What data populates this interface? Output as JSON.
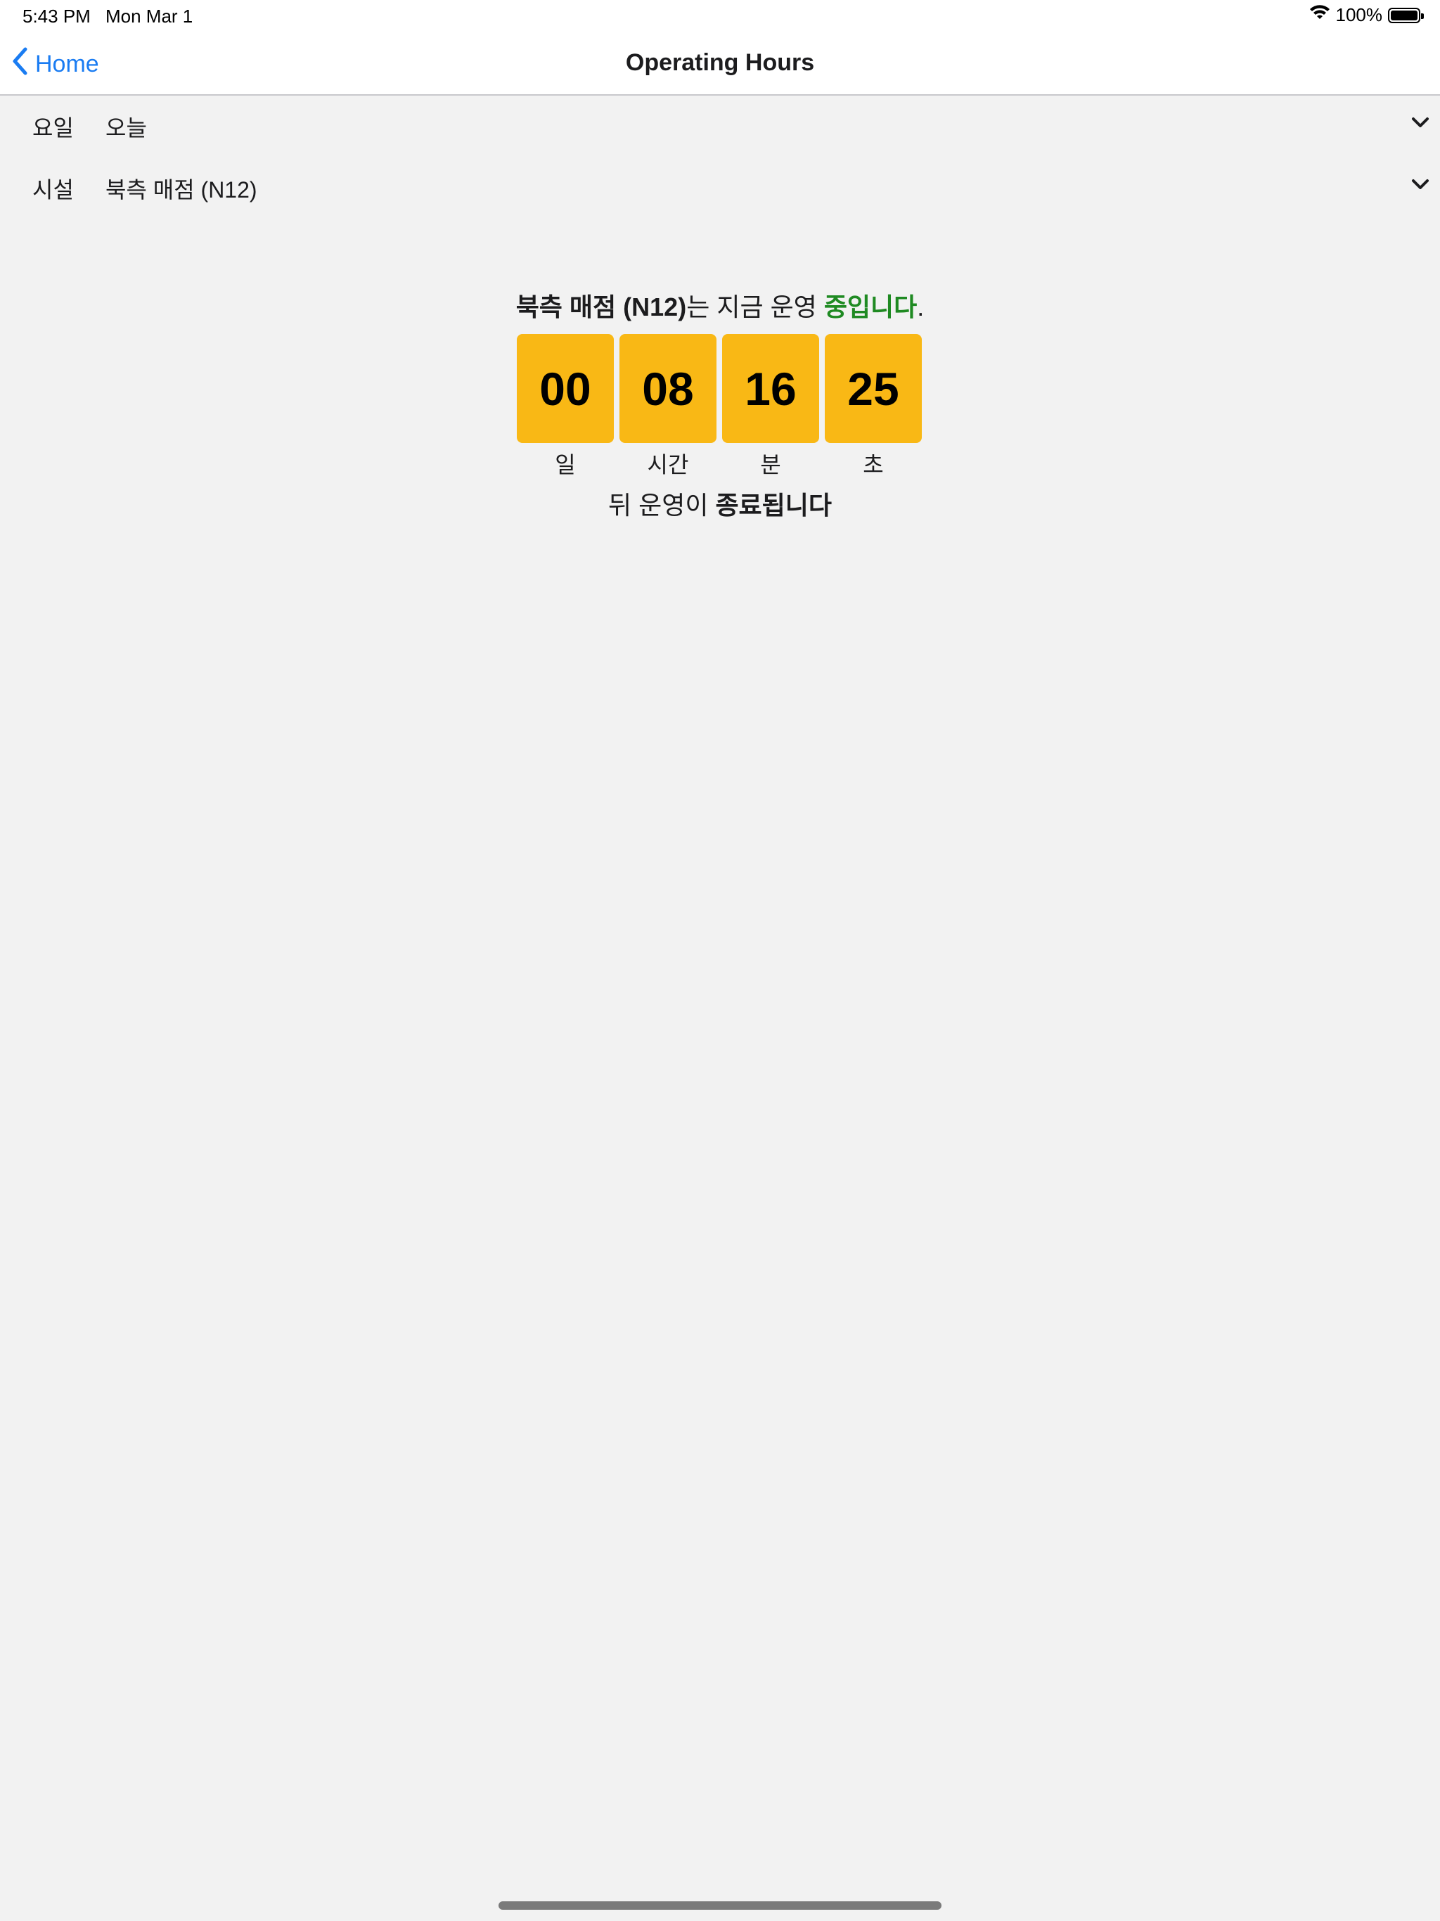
{
  "status_bar": {
    "time": "5:43 PM",
    "date": "Mon Mar 1",
    "battery": "100%"
  },
  "nav": {
    "back_label": "Home",
    "title": "Operating Hours"
  },
  "day_selector": {
    "label": "요일",
    "value": "오늘"
  },
  "facility_selector": {
    "label": "시설",
    "value": "북측 매점 (N12)"
  },
  "status_message": {
    "facility": "북측 매점 (N12)",
    "middle": "는 지금 운영 ",
    "state": "중입니다",
    "end": "."
  },
  "countdown": {
    "days": "00",
    "days_label": "일",
    "hours": "08",
    "hours_label": "시간",
    "minutes": "16",
    "minutes_label": "분",
    "seconds": "25",
    "seconds_label": "초"
  },
  "footer_message": {
    "prefix": "뒤 운영이 ",
    "emphasis": "종료됩니다"
  },
  "colors": {
    "accent": "#1a7cf2",
    "open_green": "#1f8a22",
    "tile_yellow": "#f9b815",
    "background": "#f2f2f2"
  }
}
